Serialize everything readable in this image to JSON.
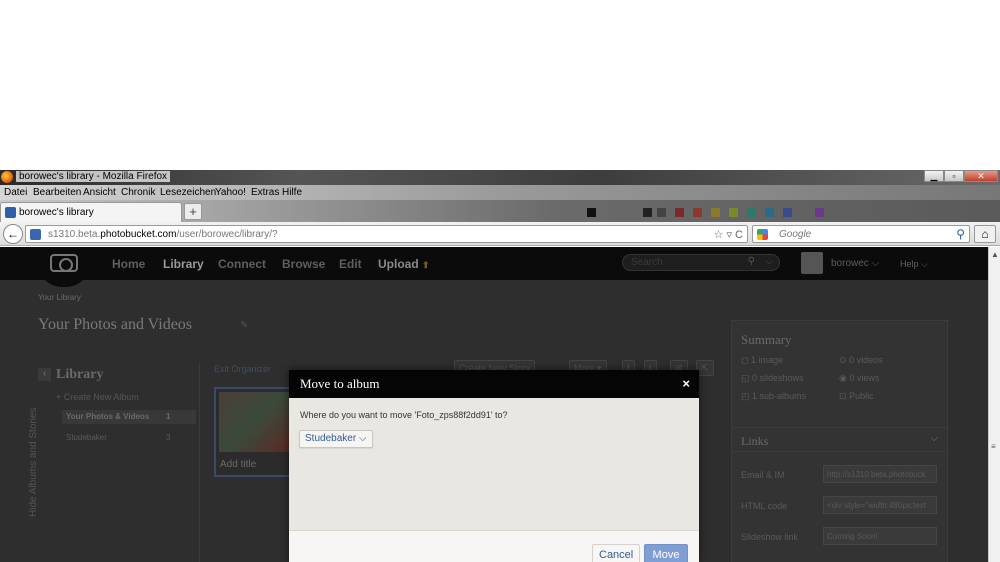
{
  "window": {
    "title": "borowec's library - Mozilla Firefox",
    "controls": {
      "minimize": "▁",
      "maximize": "▫",
      "close": "✕"
    }
  },
  "menu": [
    "Datei",
    "Bearbeiten",
    "Ansicht",
    "Chronik",
    "Lesezeichen",
    "Yahoo!",
    "Extras",
    "Hilfe"
  ],
  "tab": {
    "label": "borowec's library",
    "new_tab": "+"
  },
  "navbar": {
    "url_prefix": "s1310.beta.",
    "url_domain": "photobucket.com",
    "url_path": "/user/borowec/library/?",
    "url_icons": "☆ ▿ C",
    "search_placeholder": "Google",
    "back_icon": "←",
    "home_icon": "⌂",
    "search_icon": "⚲"
  },
  "site": {
    "nav": [
      "Home",
      "Library",
      "Connect",
      "Browse",
      "Edit",
      "Upload"
    ],
    "upload_arrow": "⬆",
    "search_placeholder": "Search",
    "user": "borowec",
    "help": "Help",
    "dropdown": "⌵"
  },
  "page": {
    "breadcrumb": "Your Library",
    "title": "Your Photos and Videos",
    "hide_albums": "Hide Albums and Stories",
    "library_heading": "Library",
    "create_album": "+ Create New Album",
    "albums": [
      {
        "name": "Your Photos & Videos",
        "count": "1"
      },
      {
        "name": "Studebaker",
        "count": "3"
      }
    ],
    "exit_organizer": "Exit Organizer",
    "add_title": "Add title",
    "toolbar": {
      "create_story": "Create New Story",
      "more": "More ▾"
    },
    "summary": {
      "heading": "Summary",
      "images": "1 image",
      "videos": "0 videos",
      "slideshows": "0 slideshows",
      "views": "0 views",
      "subalbums": "1 sub-albums",
      "privacy": "Public"
    },
    "links": {
      "heading": "Links",
      "rows": [
        {
          "label": "Email & IM",
          "value": "http://s1310.beta.photobuck"
        },
        {
          "label": "HTML code",
          "value": "<div style=\"width:480px;text"
        },
        {
          "label": "Slideshow link",
          "value": "Coming Soon!"
        }
      ]
    }
  },
  "modal": {
    "title": "Move to album",
    "close": "×",
    "question": "Where do you want to move 'Foto_zps88f2dd91' to?",
    "selected_album": "Studebaker ⌵",
    "cancel": "Cancel",
    "move": "Move"
  },
  "colors": {
    "modal_header": "#050505",
    "modal_body": "#e9e7e2",
    "primary_button": "#7f9fd4",
    "link": "#2f5a9a"
  }
}
